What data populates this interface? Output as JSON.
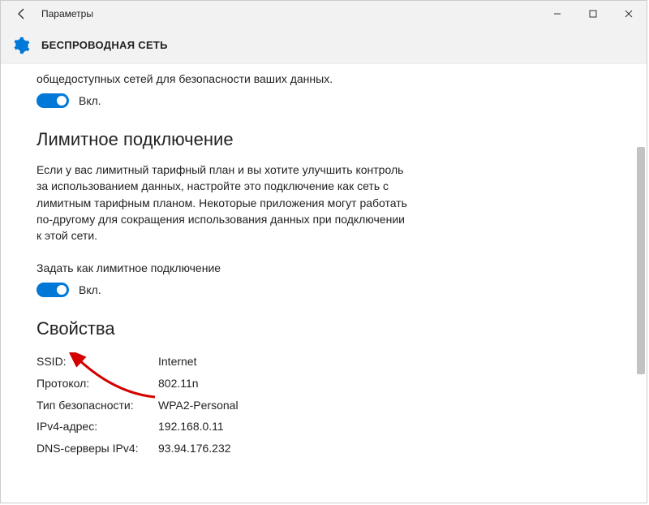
{
  "window": {
    "title": "Параметры"
  },
  "header": {
    "title": "БЕСПРОВОДНАЯ СЕТЬ"
  },
  "section_public": {
    "truncated_text": "общедоступных сетей для безопасности ваших данных.",
    "toggle_label": "Вкл."
  },
  "section_metered": {
    "heading": "Лимитное подключение",
    "description": "Если у вас лимитный тарифный план и вы хотите улучшить контроль за использованием данных, настройте это подключение как сеть с лимитным тарифным планом. Некоторые приложения могут работать по-другому для сокращения использования данных при подключении к этой сети.",
    "toggle_caption": "Задать как лимитное подключение",
    "toggle_label": "Вкл."
  },
  "section_props": {
    "heading": "Свойства",
    "rows": [
      {
        "key": "SSID:",
        "val": "Internet"
      },
      {
        "key": "Протокол:",
        "val": "802.11n"
      },
      {
        "key": "Тип безопасности:",
        "val": "WPA2-Personal"
      },
      {
        "key": "IPv4-адрес:",
        "val": "192.168.0.11"
      },
      {
        "key": "DNS-серверы IPv4:",
        "val": "93.94.176.232"
      }
    ]
  }
}
